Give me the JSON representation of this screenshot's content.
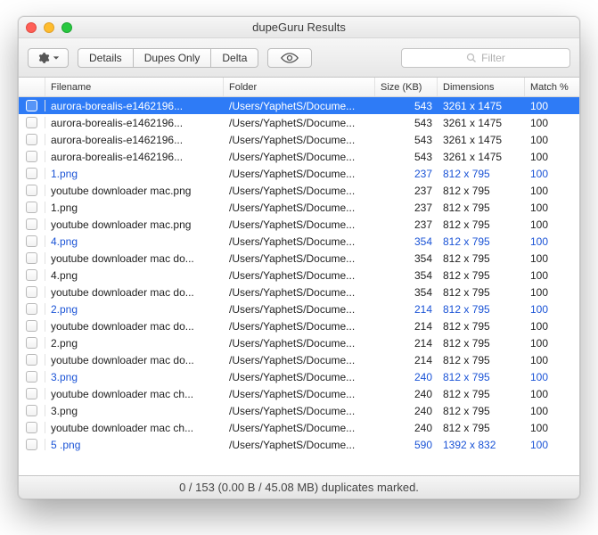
{
  "window": {
    "title": "dupeGuru Results"
  },
  "toolbar": {
    "details": "Details",
    "dupes_only": "Dupes Only",
    "delta": "Delta"
  },
  "search": {
    "placeholder": "Filter"
  },
  "columns": {
    "filename": "Filename",
    "folder": "Folder",
    "size": "Size (KB)",
    "dimensions": "Dimensions",
    "match": "Match %"
  },
  "rows": [
    {
      "selected": true,
      "group": false,
      "filename": "aurora-borealis-e1462196...",
      "folder": "/Users/YaphetS/Docume...",
      "size": "543",
      "dimensions": "3261 x 1475",
      "match": "100"
    },
    {
      "selected": false,
      "group": false,
      "filename": "aurora-borealis-e1462196...",
      "folder": "/Users/YaphetS/Docume...",
      "size": "543",
      "dimensions": "3261 x 1475",
      "match": "100"
    },
    {
      "selected": false,
      "group": false,
      "filename": "aurora-borealis-e1462196...",
      "folder": "/Users/YaphetS/Docume...",
      "size": "543",
      "dimensions": "3261 x 1475",
      "match": "100"
    },
    {
      "selected": false,
      "group": false,
      "filename": "aurora-borealis-e1462196...",
      "folder": "/Users/YaphetS/Docume...",
      "size": "543",
      "dimensions": "3261 x 1475",
      "match": "100"
    },
    {
      "selected": false,
      "group": true,
      "filename": "1.png",
      "folder": "/Users/YaphetS/Docume...",
      "size": "237",
      "dimensions": "812 x 795",
      "match": "100"
    },
    {
      "selected": false,
      "group": false,
      "filename": "youtube downloader mac.png",
      "folder": "/Users/YaphetS/Docume...",
      "size": "237",
      "dimensions": "812 x 795",
      "match": "100"
    },
    {
      "selected": false,
      "group": false,
      "filename": "1.png",
      "folder": "/Users/YaphetS/Docume...",
      "size": "237",
      "dimensions": "812 x 795",
      "match": "100"
    },
    {
      "selected": false,
      "group": false,
      "filename": "youtube downloader mac.png",
      "folder": "/Users/YaphetS/Docume...",
      "size": "237",
      "dimensions": "812 x 795",
      "match": "100"
    },
    {
      "selected": false,
      "group": true,
      "filename": "4.png",
      "folder": "/Users/YaphetS/Docume...",
      "size": "354",
      "dimensions": "812 x 795",
      "match": "100"
    },
    {
      "selected": false,
      "group": false,
      "filename": "youtube downloader mac do...",
      "folder": "/Users/YaphetS/Docume...",
      "size": "354",
      "dimensions": "812 x 795",
      "match": "100"
    },
    {
      "selected": false,
      "group": false,
      "filename": "4.png",
      "folder": "/Users/YaphetS/Docume...",
      "size": "354",
      "dimensions": "812 x 795",
      "match": "100"
    },
    {
      "selected": false,
      "group": false,
      "filename": "youtube downloader mac do...",
      "folder": "/Users/YaphetS/Docume...",
      "size": "354",
      "dimensions": "812 x 795",
      "match": "100"
    },
    {
      "selected": false,
      "group": true,
      "filename": "2.png",
      "folder": "/Users/YaphetS/Docume...",
      "size": "214",
      "dimensions": "812 x 795",
      "match": "100"
    },
    {
      "selected": false,
      "group": false,
      "filename": "youtube downloader mac do...",
      "folder": "/Users/YaphetS/Docume...",
      "size": "214",
      "dimensions": "812 x 795",
      "match": "100"
    },
    {
      "selected": false,
      "group": false,
      "filename": "2.png",
      "folder": "/Users/YaphetS/Docume...",
      "size": "214",
      "dimensions": "812 x 795",
      "match": "100"
    },
    {
      "selected": false,
      "group": false,
      "filename": "youtube downloader mac do...",
      "folder": "/Users/YaphetS/Docume...",
      "size": "214",
      "dimensions": "812 x 795",
      "match": "100"
    },
    {
      "selected": false,
      "group": true,
      "filename": "3.png",
      "folder": "/Users/YaphetS/Docume...",
      "size": "240",
      "dimensions": "812 x 795",
      "match": "100"
    },
    {
      "selected": false,
      "group": false,
      "filename": "youtube downloader mac ch...",
      "folder": "/Users/YaphetS/Docume...",
      "size": "240",
      "dimensions": "812 x 795",
      "match": "100"
    },
    {
      "selected": false,
      "group": false,
      "filename": "3.png",
      "folder": "/Users/YaphetS/Docume...",
      "size": "240",
      "dimensions": "812 x 795",
      "match": "100"
    },
    {
      "selected": false,
      "group": false,
      "filename": "youtube downloader mac ch...",
      "folder": "/Users/YaphetS/Docume...",
      "size": "240",
      "dimensions": "812 x 795",
      "match": "100"
    },
    {
      "selected": false,
      "group": true,
      "filename": "5 .png",
      "folder": "/Users/YaphetS/Docume...",
      "size": "590",
      "dimensions": "1392 x 832",
      "match": "100"
    }
  ],
  "status": "0 / 153 (0.00 B / 45.08 MB) duplicates marked."
}
